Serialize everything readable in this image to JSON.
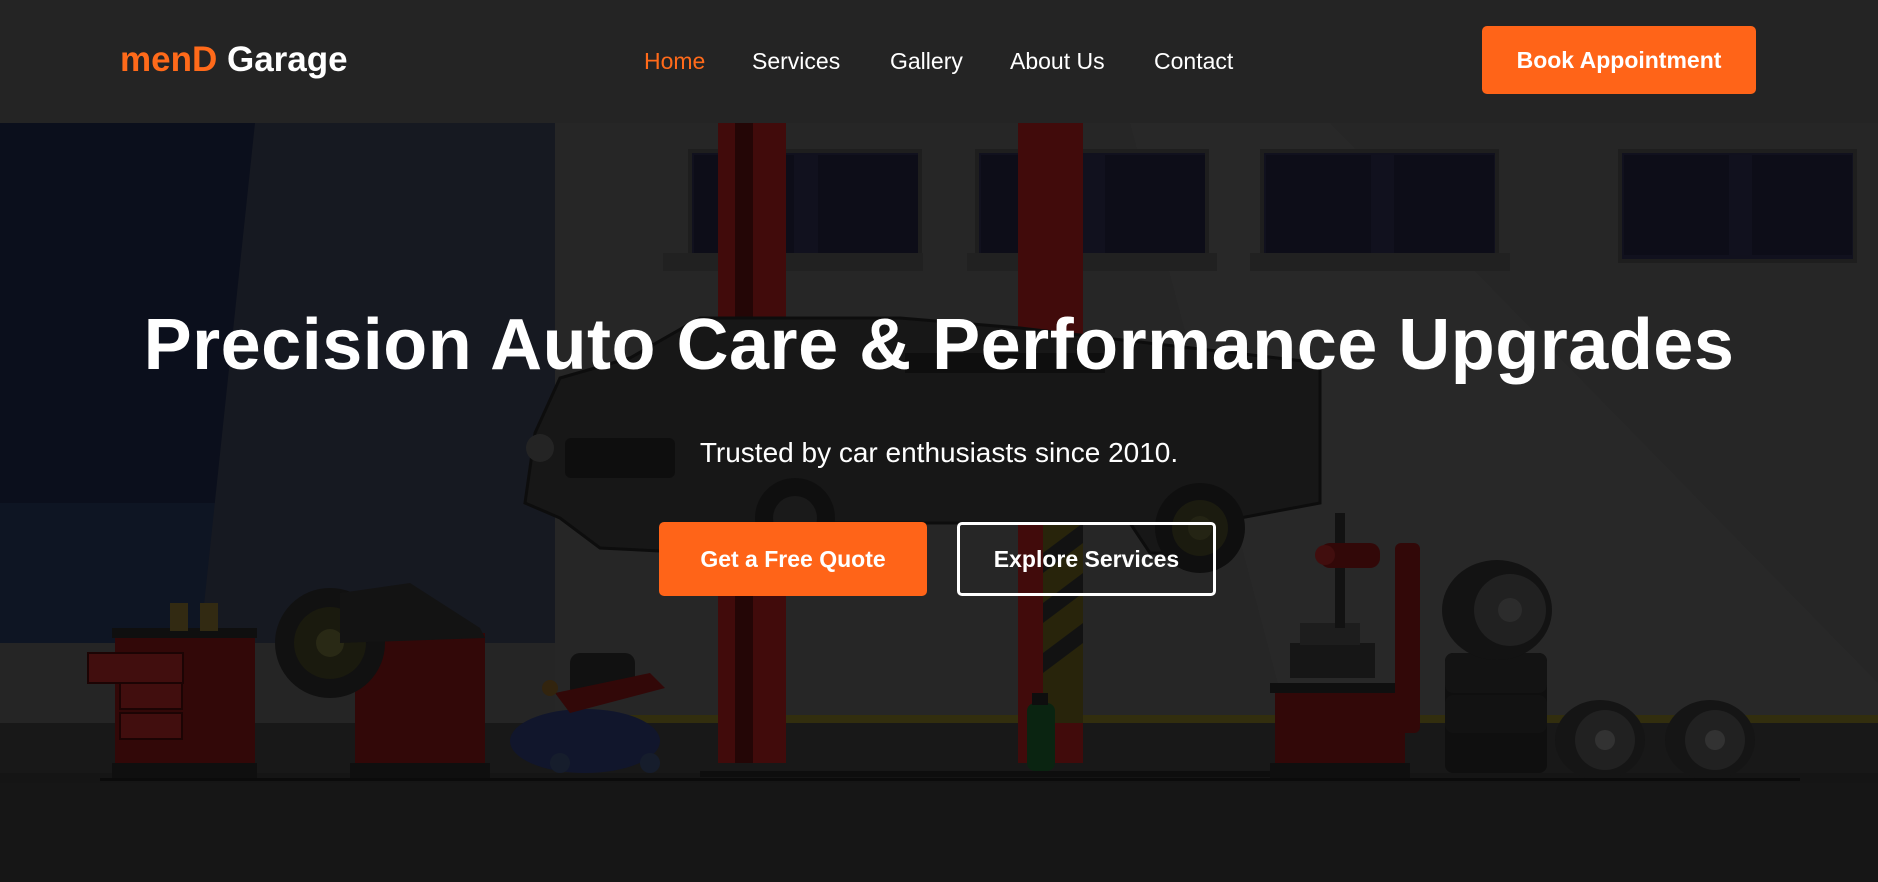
{
  "brand": {
    "part1": "menD",
    "part2": "Garage"
  },
  "nav": {
    "items": [
      {
        "label": "Home",
        "active": true
      },
      {
        "label": "Services",
        "active": false
      },
      {
        "label": "Gallery",
        "active": false
      },
      {
        "label": "About Us",
        "active": false
      },
      {
        "label": "Contact",
        "active": false
      }
    ],
    "cta_label": "Book Appointment"
  },
  "hero": {
    "title": "Precision Auto Care & Performance Upgrades",
    "subtitle": "Trusted by car enthusiasts since 2010.",
    "primary_button": "Get a Free Quote",
    "secondary_button": "Explore Services"
  },
  "colors": {
    "accent": "#ff6418",
    "navbar_bg": "#242424",
    "text": "#ffffff"
  },
  "icons": {
    "hero_background": "garage-illustration"
  }
}
